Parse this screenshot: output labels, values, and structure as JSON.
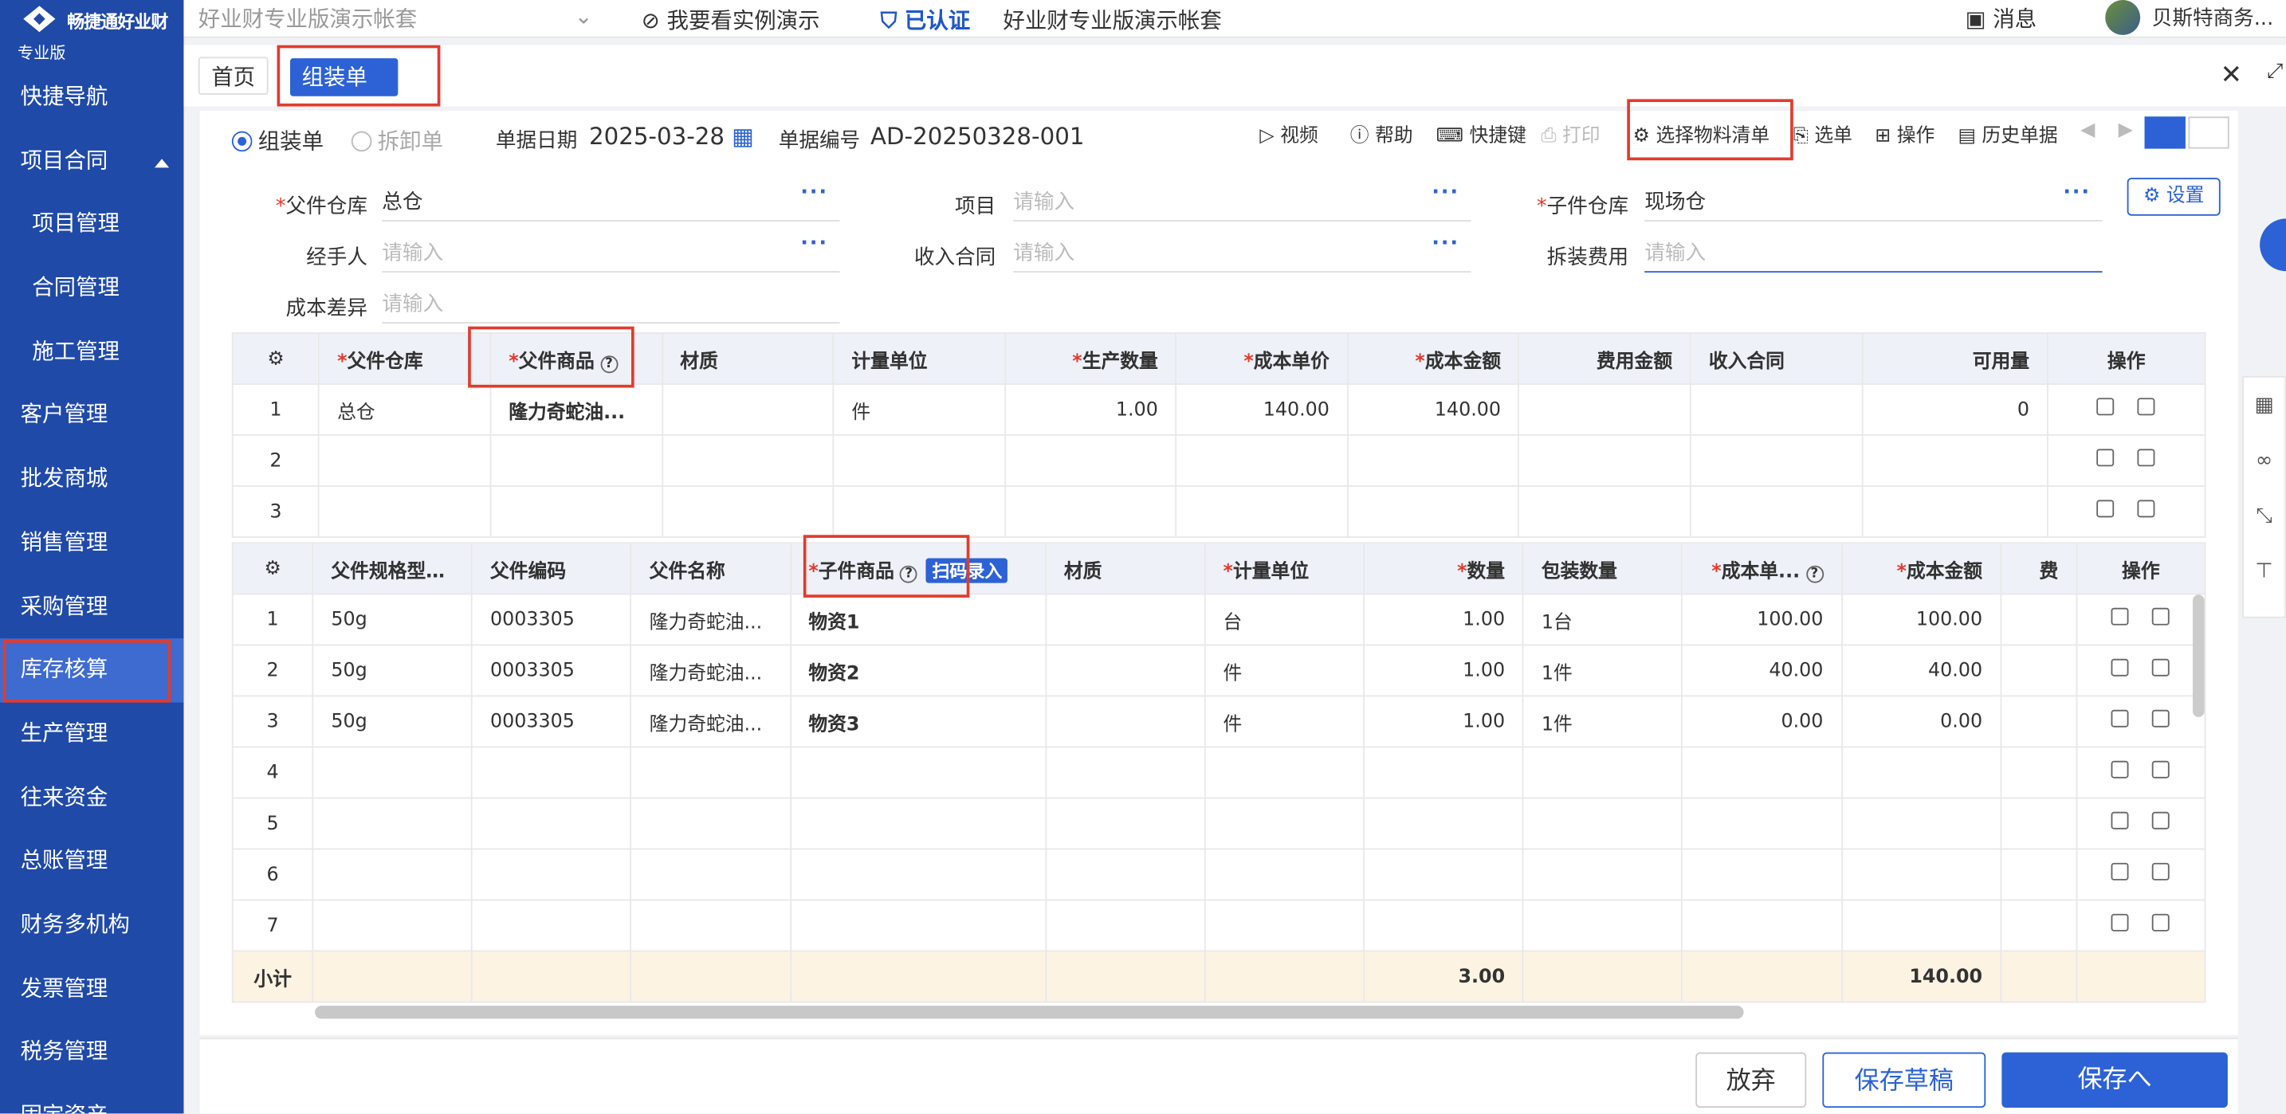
{
  "brand": {
    "name": "畅捷通好业财",
    "edition": "专业版"
  },
  "sidebar": {
    "items": [
      {
        "label": "快捷导航"
      },
      {
        "label": "项目合同"
      },
      {
        "label": "项目管理"
      },
      {
        "label": "合同管理"
      },
      {
        "label": "施工管理"
      },
      {
        "label": "客户管理"
      },
      {
        "label": "批发商城"
      },
      {
        "label": "销售管理"
      },
      {
        "label": "采购管理"
      },
      {
        "label": "库存核算"
      },
      {
        "label": "生产管理"
      },
      {
        "label": "往来资金"
      },
      {
        "label": "总账管理"
      },
      {
        "label": "财务多机构"
      },
      {
        "label": "发票管理"
      },
      {
        "label": "税务管理"
      },
      {
        "label": "固定资产"
      }
    ]
  },
  "topbar": {
    "account_select": "好业财专业版演示帐套",
    "demo": "我要看实例演示",
    "auth": "已认证",
    "account_name": "好业财专业版演示帐套",
    "message": "消息",
    "user": "贝斯特商务..."
  },
  "tabs": {
    "home": "首页",
    "active": "组装单 ×"
  },
  "toolbar": {
    "radio_assemble": "组装单",
    "radio_disassemble": "拆卸单",
    "date_label": "单据日期",
    "date_value": "2025-03-28",
    "no_label": "单据编号",
    "no_value": "AD-20250328-001",
    "video": "视频",
    "help": "帮助",
    "shortcut": "快捷键",
    "print": "打印",
    "select_bom": "选择物料清单",
    "select": "选单",
    "operate": "操作",
    "history": "历史单据"
  },
  "form": {
    "parent_wh_label": "父件仓库",
    "parent_wh_value": "总仓",
    "project_label": "项目",
    "project_ph": "请输入",
    "child_wh_label": "子件仓库",
    "child_wh_value": "现场仓",
    "settings": "设置",
    "handler_label": "经手人",
    "handler_ph": "请输入",
    "income_label": "收入合同",
    "income_ph": "请输入",
    "fee_label": "拆装费用",
    "fee_ph": "请输入",
    "diff_label": "成本差异",
    "diff_ph": "请输入"
  },
  "parent_table": {
    "headers": [
      "父件仓库",
      "父件商品",
      "材质",
      "计量单位",
      "生产数量",
      "成本单价",
      "成本金额",
      "费用金额",
      "收入合同",
      "可用量",
      "操作"
    ],
    "rows": [
      {
        "no": "1",
        "wh": "总仓",
        "item": "隆力奇蛇油...",
        "mat": "",
        "unit": "件",
        "qty": "1.00",
        "price": "140.00",
        "amount": "140.00",
        "fee": "",
        "contract": "",
        "avail": "0"
      },
      {
        "no": "2",
        "wh": "",
        "item": "",
        "mat": "",
        "unit": "",
        "qty": "",
        "price": "",
        "amount": "",
        "fee": "",
        "contract": "",
        "avail": ""
      },
      {
        "no": "3",
        "wh": "",
        "item": "",
        "mat": "",
        "unit": "",
        "qty": "",
        "price": "",
        "amount": "",
        "fee": "",
        "contract": "",
        "avail": ""
      }
    ]
  },
  "child_table": {
    "headers": [
      "父件规格型号 ...",
      "父件编码",
      "父件名称",
      "子件商品",
      "材质",
      "计量单位",
      "数量",
      "包装数量",
      "成本单...",
      "成本金额",
      "费",
      "操作"
    ],
    "scan": "扫码录入",
    "rows": [
      {
        "no": "1",
        "spec": "50g",
        "code": "0003305",
        "name": "隆力奇蛇油...",
        "item": "物资1",
        "mat": "",
        "unit": "台",
        "qty": "1.00",
        "pack": "1台",
        "price": "100.00",
        "amount": "100.00"
      },
      {
        "no": "2",
        "spec": "50g",
        "code": "0003305",
        "name": "隆力奇蛇油...",
        "item": "物资2",
        "mat": "",
        "unit": "件",
        "qty": "1.00",
        "pack": "1件",
        "price": "40.00",
        "amount": "40.00"
      },
      {
        "no": "3",
        "spec": "50g",
        "code": "0003305",
        "name": "隆力奇蛇油...",
        "item": "物资3",
        "mat": "",
        "unit": "件",
        "qty": "1.00",
        "pack": "1件",
        "price": "0.00",
        "amount": "0.00"
      },
      {
        "no": "4",
        "spec": "",
        "code": "",
        "name": "",
        "item": "",
        "mat": "",
        "unit": "",
        "qty": "",
        "pack": "",
        "price": "",
        "amount": ""
      },
      {
        "no": "5",
        "spec": "",
        "code": "",
        "name": "",
        "item": "",
        "mat": "",
        "unit": "",
        "qty": "",
        "pack": "",
        "price": "",
        "amount": ""
      },
      {
        "no": "6",
        "spec": "",
        "code": "",
        "name": "",
        "item": "",
        "mat": "",
        "unit": "",
        "qty": "",
        "pack": "",
        "price": "",
        "amount": ""
      },
      {
        "no": "7",
        "spec": "",
        "code": "",
        "name": "",
        "item": "",
        "mat": "",
        "unit": "",
        "qty": "",
        "pack": "",
        "price": "",
        "amount": ""
      }
    ],
    "subtotal_label": "小计",
    "subtotal_qty": "3.00",
    "subtotal_amount": "140.00"
  },
  "footer": {
    "discard": "放弃",
    "save_draft": "保存草稿",
    "save": "保存へ"
  },
  "colors": {
    "primary": "#2c62d5",
    "sidebar": "#1f4aa8",
    "highlight": "#e23b2e"
  }
}
